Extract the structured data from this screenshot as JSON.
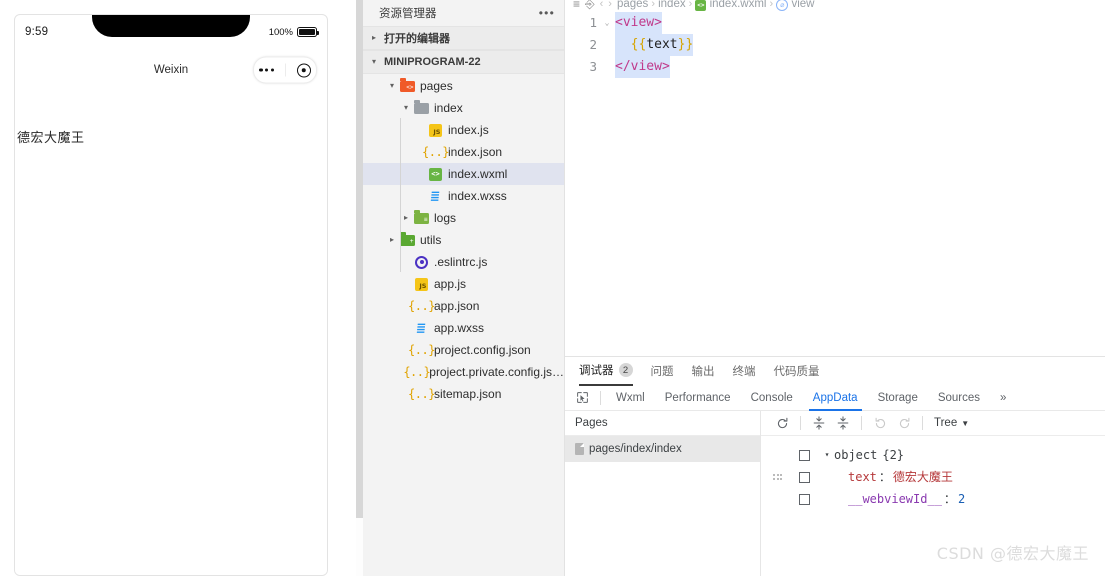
{
  "simulator": {
    "status_time": "9:59",
    "battery_pct": "100%",
    "nav_title": "Weixin",
    "page_text": "德宏大魔王"
  },
  "explorer": {
    "title": "资源管理器",
    "more_label": "•••",
    "open_editors_label": "打开的编辑器",
    "project_label": "MINIPROGRAM-22",
    "tree": [
      {
        "label": "pages",
        "icon": "folder-pages-icon",
        "depth": 1,
        "twisty": "▾",
        "selected": false
      },
      {
        "label": "index",
        "icon": "folder-icon",
        "depth": 2,
        "twisty": "▾",
        "selected": false
      },
      {
        "label": "index.js",
        "icon": "js-file-icon",
        "depth": 3,
        "twisty": "",
        "selected": false
      },
      {
        "label": "index.json",
        "icon": "json-file-icon",
        "depth": 3,
        "twisty": "",
        "selected": false
      },
      {
        "label": "index.wxml",
        "icon": "wxml-file-icon",
        "depth": 3,
        "twisty": "",
        "selected": true
      },
      {
        "label": "index.wxss",
        "icon": "wxss-file-icon",
        "depth": 3,
        "twisty": "",
        "selected": false
      },
      {
        "label": "logs",
        "icon": "folder-logs-icon",
        "depth": 2,
        "twisty": "▸",
        "selected": false
      },
      {
        "label": "utils",
        "icon": "folder-utils-icon",
        "depth": 1,
        "twisty": "▸",
        "selected": false
      },
      {
        "label": ".eslintrc.js",
        "icon": "eslint-file-icon",
        "depth": 2,
        "twisty": "",
        "selected": false
      },
      {
        "label": "app.js",
        "icon": "js-file-icon",
        "depth": 2,
        "twisty": "",
        "selected": false
      },
      {
        "label": "app.json",
        "icon": "json-file-icon",
        "depth": 2,
        "twisty": "",
        "selected": false
      },
      {
        "label": "app.wxss",
        "icon": "wxss-file-icon",
        "depth": 2,
        "twisty": "",
        "selected": false
      },
      {
        "label": "project.config.json",
        "icon": "json-file-icon",
        "depth": 2,
        "twisty": "",
        "selected": false
      },
      {
        "label": "project.private.config.js…",
        "icon": "json-file-icon",
        "depth": 2,
        "twisty": "",
        "selected": false
      },
      {
        "label": "sitemap.json",
        "icon": "json-file-icon",
        "depth": 2,
        "twisty": "",
        "selected": false
      }
    ]
  },
  "editor": {
    "breadcrumb": [
      {
        "text": "pages",
        "icon": ""
      },
      {
        "text": "index",
        "icon": ""
      },
      {
        "text": "index.wxml",
        "icon": "wxml-chip-icon"
      },
      {
        "text": "view",
        "icon": "tag-circle-icon"
      }
    ],
    "lines": [
      {
        "num": "1",
        "fold": "⌄",
        "tokens": [
          {
            "t": "<view>",
            "cls": "tk-tag"
          }
        ]
      },
      {
        "num": "2",
        "fold": "",
        "tokens": [
          {
            "t": "  ",
            "cls": "tk-var"
          },
          {
            "t": "{{",
            "cls": "tk-brace"
          },
          {
            "t": "text",
            "cls": "tk-var"
          },
          {
            "t": "}}",
            "cls": "tk-brace"
          }
        ]
      },
      {
        "num": "3",
        "fold": "",
        "tokens": [
          {
            "t": "</view>",
            "cls": "tk-tag"
          }
        ]
      }
    ]
  },
  "panel": {
    "tabs": [
      {
        "label": "调试器",
        "badge": "2",
        "active": true
      },
      {
        "label": "问题",
        "badge": "",
        "active": false
      },
      {
        "label": "输出",
        "badge": "",
        "active": false
      },
      {
        "label": "终端",
        "badge": "",
        "active": false
      },
      {
        "label": "代码质量",
        "badge": "",
        "active": false
      }
    ],
    "devtools_tabs": [
      {
        "label": "Wxml",
        "active": false
      },
      {
        "label": "Performance",
        "active": false
      },
      {
        "label": "Console",
        "active": false
      },
      {
        "label": "AppData",
        "active": true
      },
      {
        "label": "Storage",
        "active": false
      },
      {
        "label": "Sources",
        "active": false
      }
    ],
    "overflow_label": "»",
    "pages": {
      "header": "Pages",
      "items": [
        "pages/index/index"
      ]
    },
    "data_toolbar": {
      "refresh_label": "⟳",
      "expand_label": "↧",
      "collapse_label": "↥",
      "undo_label": "↺",
      "redo_label": "↻",
      "mode_label": "Tree",
      "mode_caret": "▼"
    },
    "appdata": {
      "root": {
        "caret": "▾",
        "label": "object",
        "count": "{2}"
      },
      "entries": [
        {
          "key": "text",
          "key_cls": "k-name",
          "sep": "：",
          "value": "德宏大魔王",
          "value_cls": "v-cn",
          "draggable": true
        },
        {
          "key": "__webviewId__",
          "key_cls": "k-name2",
          "sep": "：",
          "value": "2",
          "value_cls": "v-num",
          "draggable": false
        }
      ]
    }
  },
  "watermark": "CSDN @德宏大魔王"
}
